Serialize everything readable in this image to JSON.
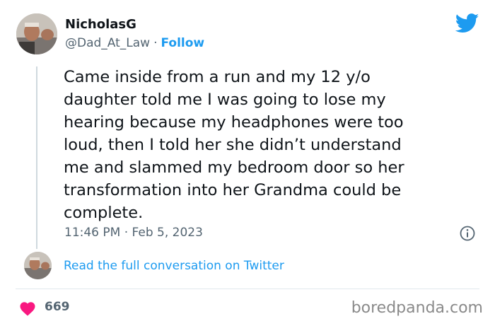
{
  "author": {
    "name": "NicholasG",
    "handle": "@Dad_At_Law",
    "separator": "·",
    "follow_label": "Follow"
  },
  "tweet": {
    "text": "Came inside from a run and my 12 y/o\ndaughter told me I was going to lose my\nhearing because my headphones were too\nloud, then I told her she didn’t understand\nme and slammed my bedroom door so her\ntransformation into her Grandma could be\ncomplete.",
    "timestamp": "11:46 PM · Feb 5, 2023"
  },
  "thread": {
    "read_link": "Read the full conversation on Twitter"
  },
  "engagement": {
    "likes": "669"
  },
  "watermark": "boredpanda.com",
  "icons": {
    "brand": "twitter-bird-icon",
    "info": "info-icon",
    "like": "heart-icon"
  },
  "colors": {
    "twitter_blue": "#1d9bf0",
    "like_red": "#f91880",
    "secondary_text": "#536471"
  }
}
